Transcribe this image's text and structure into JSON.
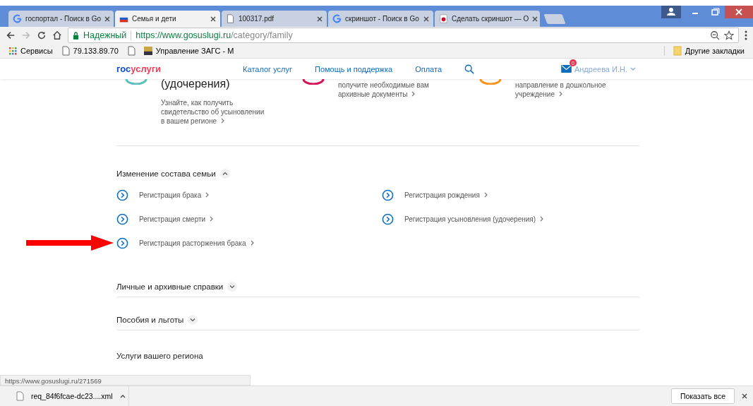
{
  "tabs": [
    {
      "label": "госпортал - Поиск в Go",
      "kind": "search",
      "selected": false
    },
    {
      "label": "Семья и дети",
      "kind": "site",
      "selected": true
    },
    {
      "label": "100317.pdf",
      "kind": "document",
      "selected": false
    },
    {
      "label": "скриншот - Поиск в Go",
      "kind": "search",
      "selected": false
    },
    {
      "label": "Сделать скриншот — O",
      "kind": "extension",
      "selected": false
    }
  ],
  "address": {
    "security": "Надежный",
    "host": "https://www.gosuslugi.ru",
    "path": "/category/family"
  },
  "bookmarks": [
    {
      "label": "Сервисы",
      "kind": "apps"
    },
    {
      "label": "79.133.89.70",
      "kind": "page"
    },
    {
      "kind": "page"
    },
    {
      "label": "Управление ЗАГС - М",
      "kind": "site"
    }
  ],
  "other_bookmarks": "Другие закладки",
  "site": {
    "logo_a": "гос",
    "logo_b": "услуги",
    "nav": [
      "Каталог услуг",
      "Помощь и поддержка",
      "Оплата"
    ],
    "mail_count": "0",
    "user": "Андреева И.Н."
  },
  "cards": [
    {
      "title": "(удочерения)",
      "text": "Узнайте, как получить свидетельство об усыновлении в вашем регионе",
      "color": "#5bc0be"
    },
    {
      "text": "получите необходимые вам архивные документы",
      "color": "#d4145a"
    },
    {
      "text": "направление в дошкольное учреждение",
      "color": "#f7931e"
    }
  ],
  "sections": [
    {
      "title": "Изменение состава семьи",
      "expanded": true,
      "items": [
        "Регистрация брака",
        "Регистрация рождения",
        "Регистрация смерти",
        "Регистрация усыновления (удочерения)",
        "Регистрация расторжения брака"
      ]
    },
    {
      "title": "Личные и архивные справки",
      "expanded": false
    },
    {
      "title": "Пособия и льготы",
      "expanded": false
    }
  ],
  "region_title": "Услуги вашего региона",
  "status_url": "https://www.gosuslugi.ru/271569",
  "download": {
    "file": "req_84f6fcae-dc23....xml",
    "show_all": "Показать все"
  }
}
